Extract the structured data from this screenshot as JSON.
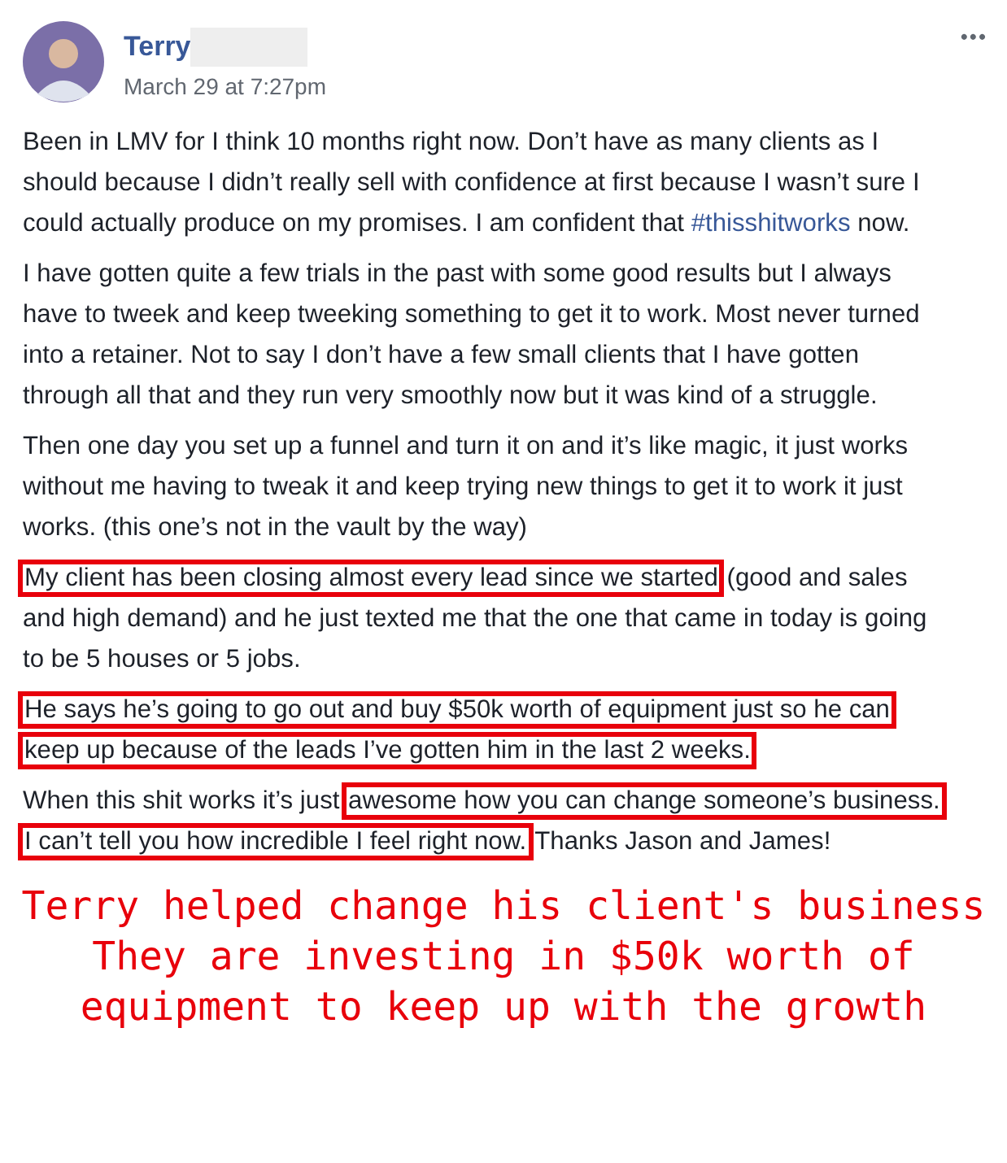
{
  "post": {
    "author": "Terry",
    "author_redacted": true,
    "timestamp": "March 29 at 7:27pm",
    "menu": "•••",
    "paragraphs": [
      {
        "segments": [
          {
            "kind": "text",
            "text": "Been in LMV for I think 10 months right now. Don’t have as many clients as I should because I didn’t really sell with confidence at first because I wasn’t sure I could actually produce on my promises. I am confident that ",
            "highlighted": false
          },
          {
            "kind": "hashtag",
            "text": "#thisshitworks",
            "highlighted": false
          },
          {
            "kind": "text",
            "text": " now.",
            "highlighted": false
          }
        ]
      },
      {
        "segments": [
          {
            "kind": "text",
            "text": "I have gotten quite a few trials in the past with some good results but I always have to tweek and keep tweeking something to get it to work. Most never turned into a retainer. Not to say I don’t have a few small clients that I have gotten through all that and they run very smoothly now but it was kind of a struggle.",
            "highlighted": false
          }
        ]
      },
      {
        "segments": [
          {
            "kind": "text",
            "text": "Then one day you set up a funnel and turn it on and it’s like magic, it just works without me having to tweak it and keep trying new things to get it to work it just works. (this one’s not in the vault by the way)",
            "highlighted": false
          }
        ]
      },
      {
        "segments": [
          {
            "kind": "text",
            "text": "My client has been closing almost every lead since we started",
            "highlighted": true
          },
          {
            "kind": "text",
            "text": " (good and sales and high demand) and he just texted me that the one that came in today is going to be 5 houses or 5 jobs.",
            "highlighted": false
          }
        ]
      },
      {
        "segments": [
          {
            "kind": "text",
            "text": "He says he’s going to go out and buy $50k worth of equipment just so he can keep up because of the leads I’ve gotten him in the last 2 weeks.",
            "highlighted": true
          }
        ]
      },
      {
        "segments": [
          {
            "kind": "text",
            "text": "When this shit works it’s just ",
            "highlighted": false
          },
          {
            "kind": "text",
            "text": "awesome how you can change someone’s business. I can’t tell you how incredible I feel right now.",
            "highlighted": true
          },
          {
            "kind": "text",
            "text": " Thanks Jason and James!",
            "highlighted": false
          }
        ]
      }
    ]
  },
  "caption": [
    "Terry helped change his client's business",
    "They are investing in $50k worth of",
    "equipment to keep up with the growth"
  ]
}
